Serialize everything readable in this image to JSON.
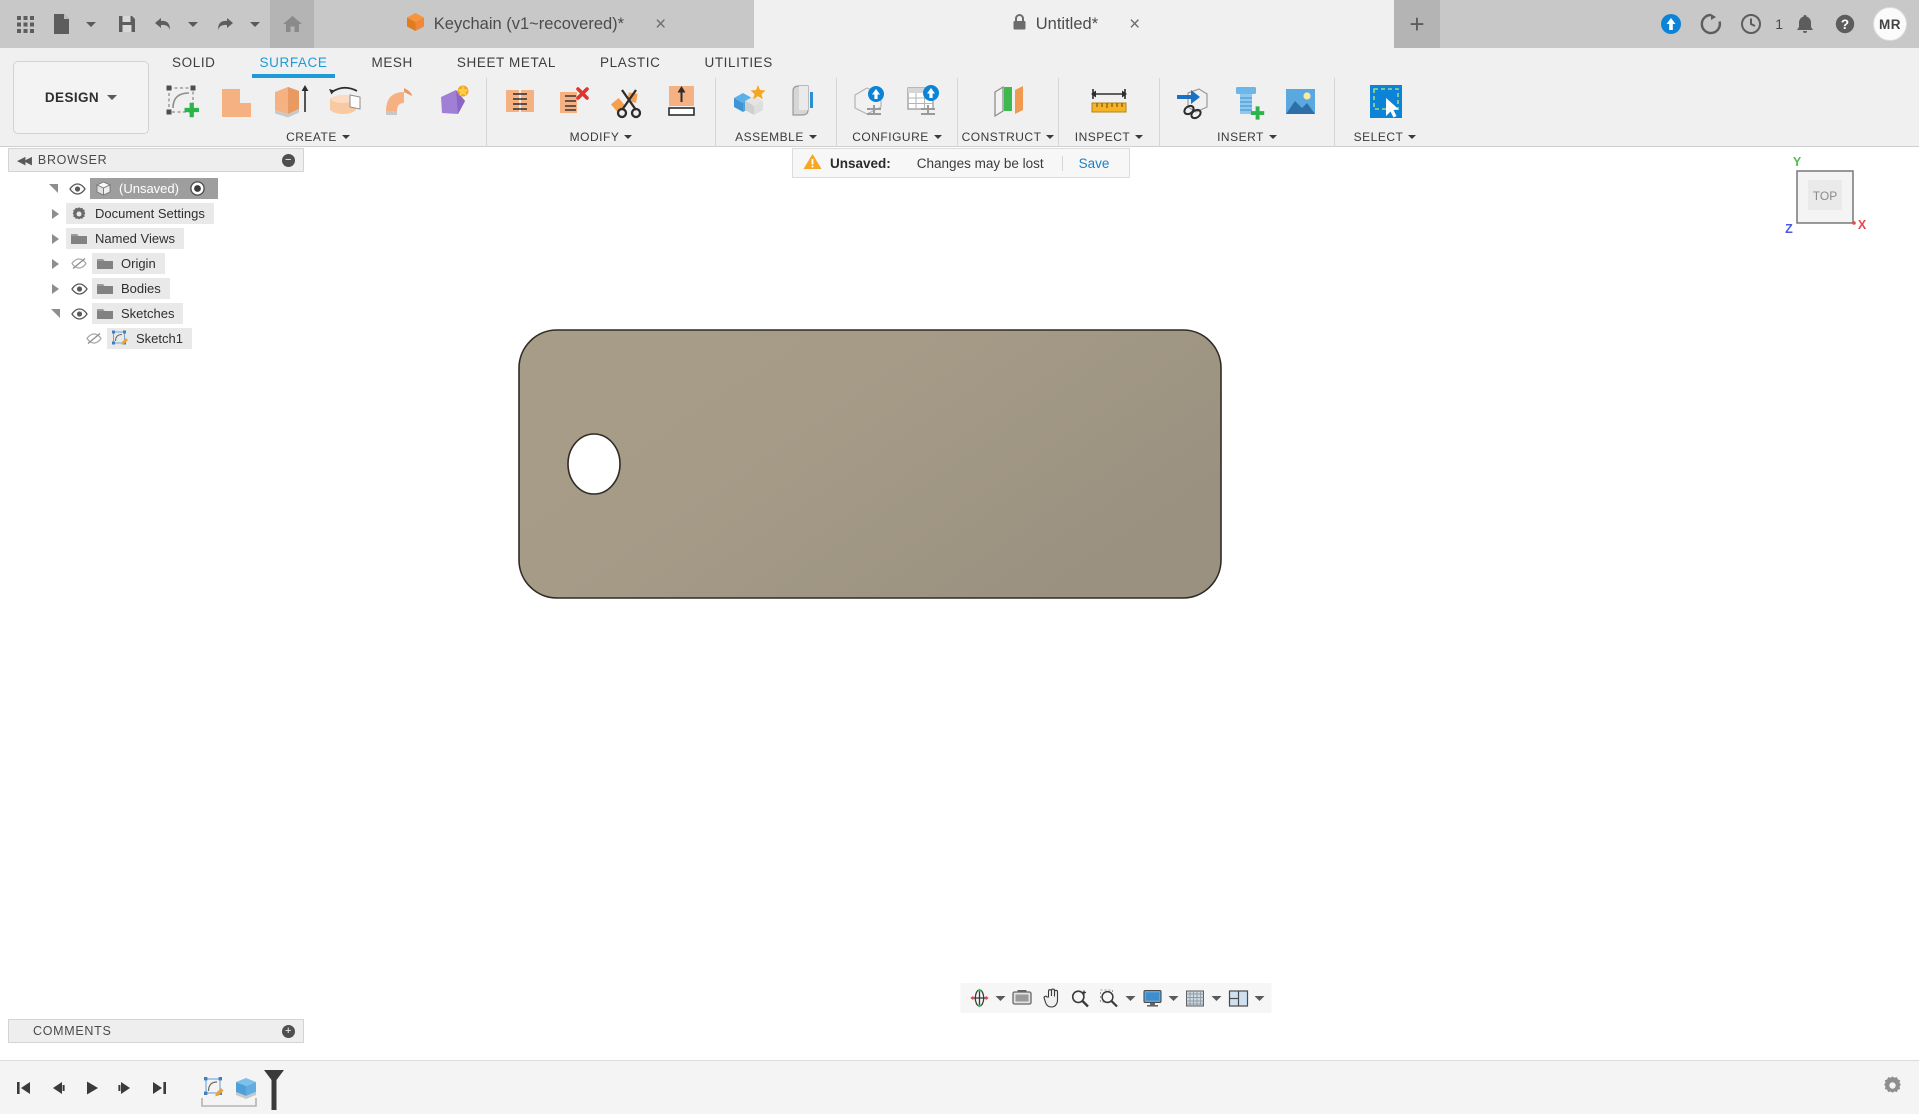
{
  "app": {
    "accent_blue": "#1e9ad6",
    "link_blue": "#1e7fc4",
    "titlebar_bg": "#c8c8c8",
    "body_color": "#a19783",
    "warn_orange": "#f5a623"
  },
  "titlebar": {
    "quick_access": [
      {
        "name": "app-grid-icon",
        "label": "Show Data Panel"
      },
      {
        "name": "file-icon",
        "label": "File"
      },
      {
        "name": "save-icon",
        "label": "Save"
      },
      {
        "name": "undo-icon",
        "label": "Undo"
      },
      {
        "name": "redo-icon",
        "label": "Redo"
      },
      {
        "name": "home-icon",
        "label": "Home"
      }
    ],
    "tabs": [
      {
        "label": "Keychain (v1~recovered)*",
        "icon": "cube-icon",
        "active": false,
        "closable": true
      },
      {
        "label": "Untitled*",
        "icon": "lock-icon",
        "active": true,
        "closable": true
      }
    ],
    "new_tab_label": "+",
    "close_glyph": "×",
    "right_icons": [
      {
        "name": "upload-status-icon",
        "label": "Job Status"
      },
      {
        "name": "refresh-icon",
        "label": "Refresh"
      },
      {
        "name": "clock-icon",
        "label": "Pending Jobs",
        "badge": "1"
      },
      {
        "name": "bell-icon",
        "label": "Notifications"
      },
      {
        "name": "help-icon",
        "label": "Help"
      }
    ],
    "avatar_initials": "MR"
  },
  "ribbon": {
    "workspace_button": "DESIGN",
    "tabs": [
      {
        "label": "SOLID",
        "active": false
      },
      {
        "label": "SURFACE",
        "active": true
      },
      {
        "label": "MESH",
        "active": false
      },
      {
        "label": "SHEET METAL",
        "active": false
      },
      {
        "label": "PLASTIC",
        "active": false
      },
      {
        "label": "UTILITIES",
        "active": false
      }
    ],
    "panels": [
      {
        "label": "CREATE",
        "has_dropdown": true,
        "tools": [
          {
            "name": "create-sketch-icon",
            "label": "Create Sketch"
          },
          {
            "name": "patch-icon",
            "label": "Patch"
          },
          {
            "name": "extrude-icon",
            "label": "Extrude"
          },
          {
            "name": "revolve-icon",
            "label": "Revolve"
          },
          {
            "name": "sweep-icon",
            "label": "Sweep"
          },
          {
            "name": "loft-icon",
            "label": "Loft"
          }
        ]
      },
      {
        "label": "MODIFY",
        "has_dropdown": true,
        "tools": [
          {
            "name": "stitch-icon",
            "label": "Stitch"
          },
          {
            "name": "unstitch-icon",
            "label": "Unstitch"
          },
          {
            "name": "trim-icon",
            "label": "Trim"
          },
          {
            "name": "extend-icon",
            "label": "Extend"
          }
        ]
      },
      {
        "label": "ASSEMBLE",
        "has_dropdown": true,
        "tools": [
          {
            "name": "new-component-icon",
            "label": "New Component"
          },
          {
            "name": "joint-icon",
            "label": "Joint"
          }
        ]
      },
      {
        "label": "CONFIGURE",
        "has_dropdown": true,
        "tools": [
          {
            "name": "configure-design-icon",
            "label": "Configure Design"
          },
          {
            "name": "configuration-table-icon",
            "label": "Configuration Table"
          }
        ]
      },
      {
        "label": "CONSTRUCT",
        "has_dropdown": true,
        "tools": [
          {
            "name": "offset-plane-icon",
            "label": "Offset Plane"
          }
        ]
      },
      {
        "label": "INSPECT",
        "has_dropdown": true,
        "tools": [
          {
            "name": "measure-icon",
            "label": "Measure"
          }
        ]
      },
      {
        "label": "INSERT",
        "has_dropdown": true,
        "tools": [
          {
            "name": "insert-derive-icon",
            "label": "Derive"
          },
          {
            "name": "insert-mcmaster-icon",
            "label": "Insert McMaster-Carr Component"
          },
          {
            "name": "canvas-image-icon",
            "label": "Canvas"
          }
        ]
      },
      {
        "label": "SELECT",
        "has_dropdown": true,
        "tools": [
          {
            "name": "select-icon",
            "label": "Select"
          }
        ]
      }
    ]
  },
  "browser": {
    "title": "BROWSER",
    "collapse_glyph": "◀◀",
    "nodes": [
      {
        "label": "(Unsaved)",
        "indent": 0,
        "expander": "open",
        "icon": "component-icon",
        "visibility": "visible",
        "selected": true,
        "has_radio": true
      },
      {
        "label": "Document Settings",
        "indent": 1,
        "expander": "closed",
        "icon": "gear-icon",
        "visibility": "none",
        "selected": false,
        "has_radio": false
      },
      {
        "label": "Named Views",
        "indent": 1,
        "expander": "closed",
        "icon": "folder-icon",
        "visibility": "none",
        "selected": false,
        "has_radio": false
      },
      {
        "label": "Origin",
        "indent": 1,
        "expander": "closed",
        "icon": "folder-icon",
        "visibility": "hidden",
        "selected": false,
        "has_radio": false
      },
      {
        "label": "Bodies",
        "indent": 1,
        "expander": "closed",
        "icon": "folder-icon",
        "visibility": "visible",
        "selected": false,
        "has_radio": false
      },
      {
        "label": "Sketches",
        "indent": 1,
        "expander": "open",
        "icon": "folder-icon",
        "visibility": "visible",
        "selected": false,
        "has_radio": false
      },
      {
        "label": "Sketch1",
        "indent": 2,
        "expander": "none",
        "icon": "sketch-icon",
        "visibility": "hidden",
        "selected": false,
        "has_radio": false
      }
    ]
  },
  "comments": {
    "title": "COMMENTS",
    "add_glyph": "+"
  },
  "canvas": {
    "notification": {
      "icon": "warning-icon",
      "label": "Unsaved:",
      "message": "Changes may be lost",
      "action": "Save"
    },
    "viewcube": {
      "face_label": "TOP",
      "axis_x": "X",
      "axis_y": "Y",
      "axis_z": "Z",
      "x_color": "#e8474c",
      "y_color": "#4ec04e",
      "z_color": "#4a5ae8"
    },
    "model": {
      "name": "keychain-body",
      "fill": "#a19783",
      "stroke": "#2e2b26",
      "hole_fill": "#ffffff"
    },
    "nav_bar": [
      {
        "name": "orbit-icon",
        "label": "Orbit",
        "dropdown": true
      },
      {
        "name": "look-at-icon",
        "label": "Look At",
        "dropdown": false
      },
      {
        "name": "pan-icon",
        "label": "Pan",
        "dropdown": false
      },
      {
        "name": "zoom-icon",
        "label": "Zoom",
        "dropdown": false
      },
      {
        "name": "zoom-window-icon",
        "label": "Fit",
        "dropdown": true
      },
      {
        "name": "display-settings-icon",
        "label": "Display Settings",
        "dropdown": true
      },
      {
        "name": "grid-snaps-icon",
        "label": "Grid and Snaps",
        "dropdown": true
      },
      {
        "name": "viewports-icon",
        "label": "Viewports",
        "dropdown": true
      }
    ]
  },
  "timeline": {
    "controls": [
      {
        "name": "skip-to-beginning-icon",
        "label": "Go to beginning"
      },
      {
        "name": "step-back-icon",
        "label": "Step back"
      },
      {
        "name": "play-icon",
        "label": "Play"
      },
      {
        "name": "step-forward-icon",
        "label": "Step forward"
      },
      {
        "name": "skip-to-end-icon",
        "label": "Go to end"
      }
    ],
    "features": [
      {
        "name": "timeline-sketch1",
        "label": "Sketch1",
        "icon": "sketch-icon"
      },
      {
        "name": "timeline-extrude1",
        "label": "Extrude1",
        "icon": "extrude-icon"
      }
    ],
    "marker_label": "Timeline Marker",
    "settings_icon": "gear-icon"
  }
}
